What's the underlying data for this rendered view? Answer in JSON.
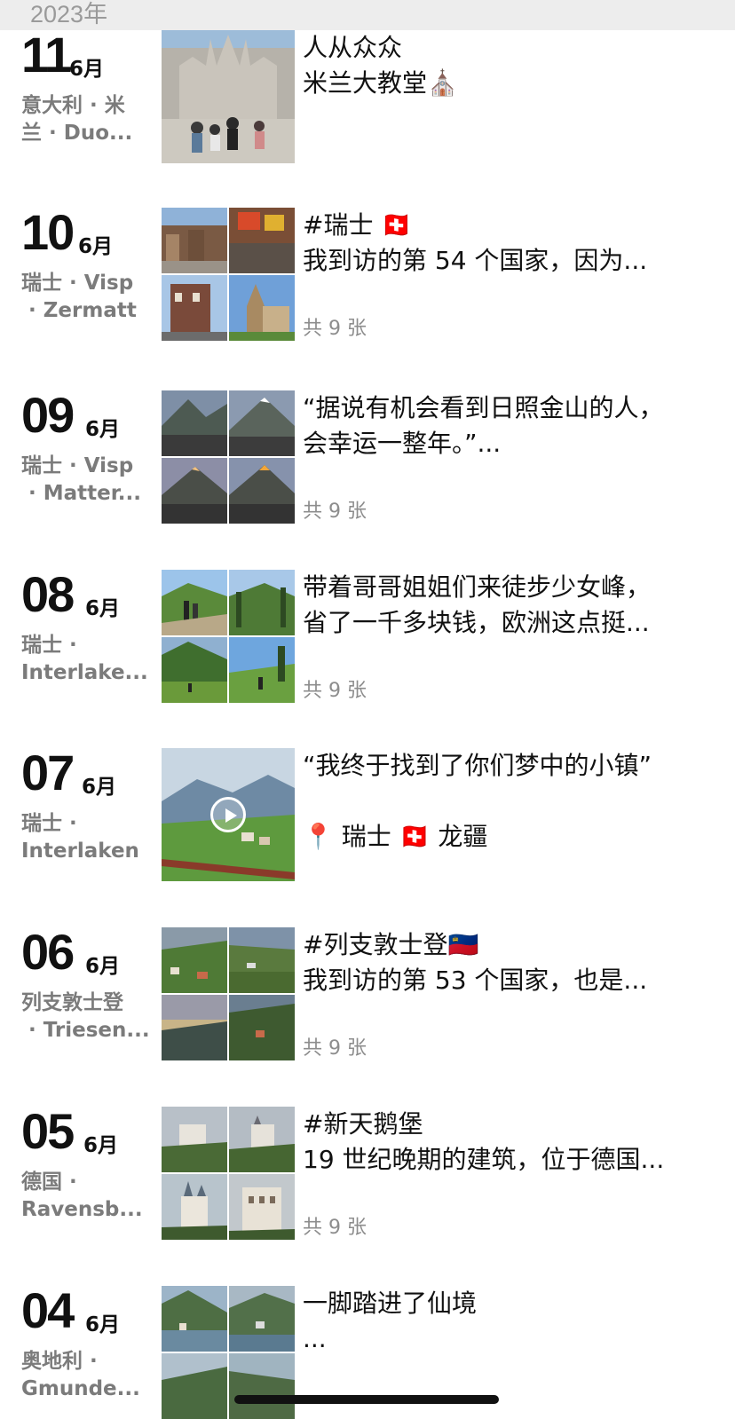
{
  "header": {
    "year": "2023年"
  },
  "entries": [
    {
      "day": "11",
      "month": "6月",
      "location": "意大利 · 米\n兰 · Duo...",
      "lines": [
        "人从众众",
        "米兰大教堂⛪"
      ],
      "count": ""
    },
    {
      "day": "10",
      "month": "6月",
      "location": "瑞士 · Visp\n · Zermatt",
      "lines": [
        "#瑞士 🇨🇭",
        "我到访的第 54 个国家，因为..."
      ],
      "count": "共 9 张"
    },
    {
      "day": "09",
      "month": "6月",
      "location": "瑞士 · Visp\n · Matter...",
      "lines": [
        "“据说有机会看到日照金山的人，",
        "会幸运一整年。”..."
      ],
      "count": "共 9 张"
    },
    {
      "day": "08",
      "month": "6月",
      "location": "瑞士 ·\nInterlake...",
      "lines": [
        "带着哥哥姐姐们来徒步少女峰，",
        "省了一千多块钱，欧洲这点挺..."
      ],
      "count": "共 9 张"
    },
    {
      "day": "07",
      "month": "6月",
      "location": "瑞士 ·\nInterlaken",
      "lines": [
        "“我终于找到了你们梦中的小镇”",
        "",
        "📍 瑞士 🇨🇭 龙疆"
      ],
      "count": ""
    },
    {
      "day": "06",
      "month": "6月",
      "location": "列支敦士登\n · Triesen...",
      "lines": [
        "#列支敦士登🇱🇮",
        "我到访的第 53 个国家，也是..."
      ],
      "count": "共 9 张"
    },
    {
      "day": "05",
      "month": "6月",
      "location": "德国 ·\nRavensb...",
      "lines": [
        "#新天鹅堡",
        "19 世纪晚期的建筑，位于德国..."
      ],
      "count": "共 9 张"
    },
    {
      "day": "04",
      "month": "6月",
      "location": "奥地利 ·\nGmunde...",
      "lines": [
        "一脚踏进了仙境",
        "..."
      ],
      "count": ""
    }
  ]
}
